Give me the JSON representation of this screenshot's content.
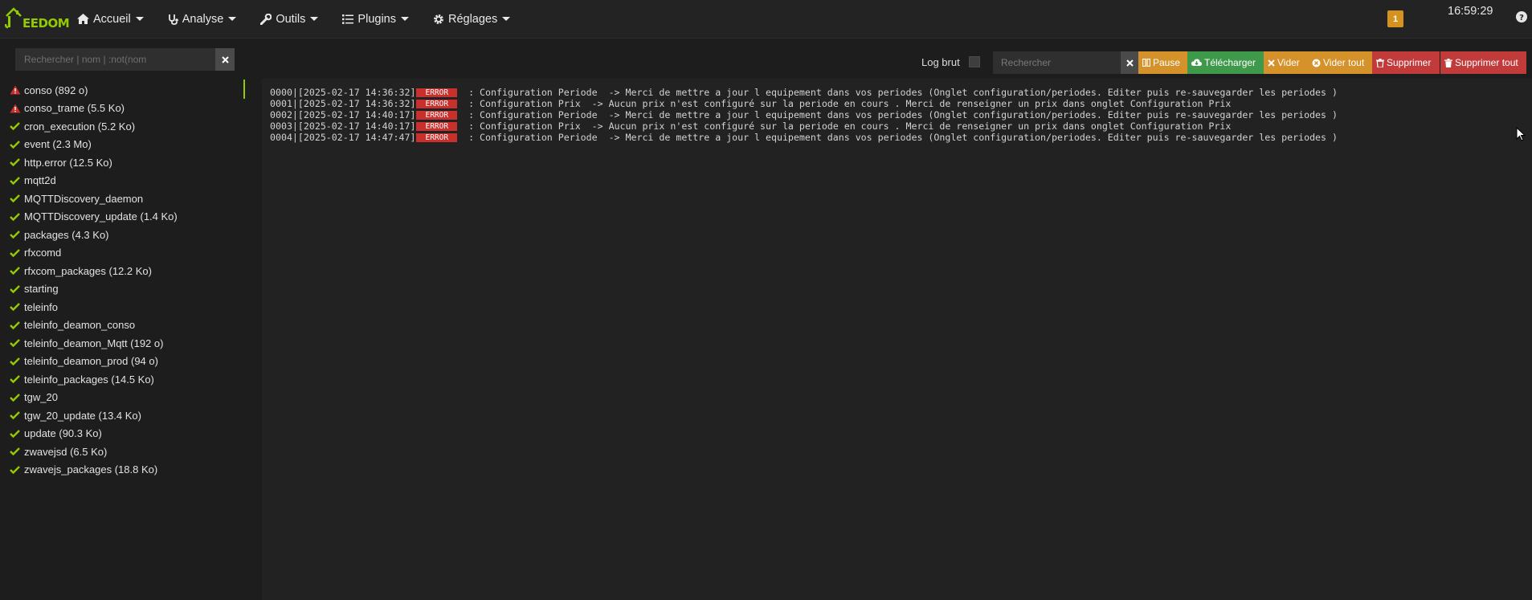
{
  "brand": {
    "logo_text": "EEDOM"
  },
  "nav": {
    "items": [
      {
        "label": "Accueil",
        "icon": "home-icon"
      },
      {
        "label": "Analyse",
        "icon": "stethoscope-icon"
      },
      {
        "label": "Outils",
        "icon": "wrench-icon"
      },
      {
        "label": "Plugins",
        "icon": "tasks-icon"
      },
      {
        "label": "Réglages",
        "icon": "cog-icon"
      }
    ],
    "notification_count": "1",
    "clock": "16:59:29"
  },
  "sidebar": {
    "search_placeholder": "Rechercher | nom | :not(nom",
    "logs": [
      {
        "label": "conso (892 o)",
        "status": "warning"
      },
      {
        "label": "conso_trame (5.5 Ko)",
        "status": "warning"
      },
      {
        "label": "cron_execution (5.2 Ko)",
        "status": "ok"
      },
      {
        "label": "event (2.3 Mo)",
        "status": "ok"
      },
      {
        "label": "http.error (12.5 Ko)",
        "status": "ok"
      },
      {
        "label": "mqtt2d",
        "status": "ok"
      },
      {
        "label": "MQTTDiscovery_daemon",
        "status": "ok"
      },
      {
        "label": "MQTTDiscovery_update (1.4 Ko)",
        "status": "ok"
      },
      {
        "label": "packages (4.3 Ko)",
        "status": "ok"
      },
      {
        "label": "rfxcomd",
        "status": "ok"
      },
      {
        "label": "rfxcom_packages (12.2 Ko)",
        "status": "ok"
      },
      {
        "label": "starting",
        "status": "ok"
      },
      {
        "label": "teleinfo",
        "status": "ok"
      },
      {
        "label": "teleinfo_deamon_conso",
        "status": "ok"
      },
      {
        "label": "teleinfo_deamon_Mqtt (192 o)",
        "status": "ok"
      },
      {
        "label": "teleinfo_deamon_prod (94 o)",
        "status": "ok"
      },
      {
        "label": "teleinfo_packages (14.5 Ko)",
        "status": "ok"
      },
      {
        "label": "tgw_20",
        "status": "ok"
      },
      {
        "label": "tgw_20_update (13.4 Ko)",
        "status": "ok"
      },
      {
        "label": "update (90.3 Ko)",
        "status": "ok"
      },
      {
        "label": "zwavejsd (6.5 Ko)",
        "status": "ok"
      },
      {
        "label": "zwavejs_packages (18.8 Ko)",
        "status": "ok"
      }
    ]
  },
  "toolbar": {
    "log_brut_label": "Log brut",
    "search_placeholder": "Rechercher",
    "pause_label": "Pause",
    "download_label": "Télécharger",
    "clear_label": "Vider",
    "clear_all_label": "Vider tout",
    "delete_label": "Supprimer",
    "delete_all_label": "Supprimer tout"
  },
  "log_lines": [
    {
      "prefix": "0000|[2025-02-17 14:36:32]",
      "level": "ERROR",
      "message": " : Configuration Periode  -> Merci de mettre a jour l equipement dans vos periodes (Onglet configuration/periodes. Editer puis re-sauvegarder les periodes )"
    },
    {
      "prefix": "0001|[2025-02-17 14:36:32]",
      "level": "ERROR",
      "message": " : Configuration Prix  -> Aucun prix n'est configuré sur la periode en cours . Merci de renseigner un prix dans onglet Configuration Prix"
    },
    {
      "prefix": "0002|[2025-02-17 14:40:17]",
      "level": "ERROR",
      "message": " : Configuration Periode  -> Merci de mettre a jour l equipement dans vos periodes (Onglet configuration/periodes. Editer puis re-sauvegarder les periodes )"
    },
    {
      "prefix": "0003|[2025-02-17 14:40:17]",
      "level": "ERROR",
      "message": " : Configuration Prix  -> Aucun prix n'est configuré sur la periode en cours . Merci de renseigner un prix dans onglet Configuration Prix"
    },
    {
      "prefix": "0004|[2025-02-17 14:47:47]",
      "level": "ERROR",
      "message": " : Configuration Periode  -> Merci de mettre a jour l equipement dans vos periodes (Onglet configuration/periodes. Editer puis re-sauvegarder les periodes )"
    }
  ],
  "colors": {
    "accent": "#94ca02",
    "warning": "#c9302c",
    "orange": "#d6922a",
    "green": "#3e9a4a",
    "red": "#c23b3b"
  }
}
